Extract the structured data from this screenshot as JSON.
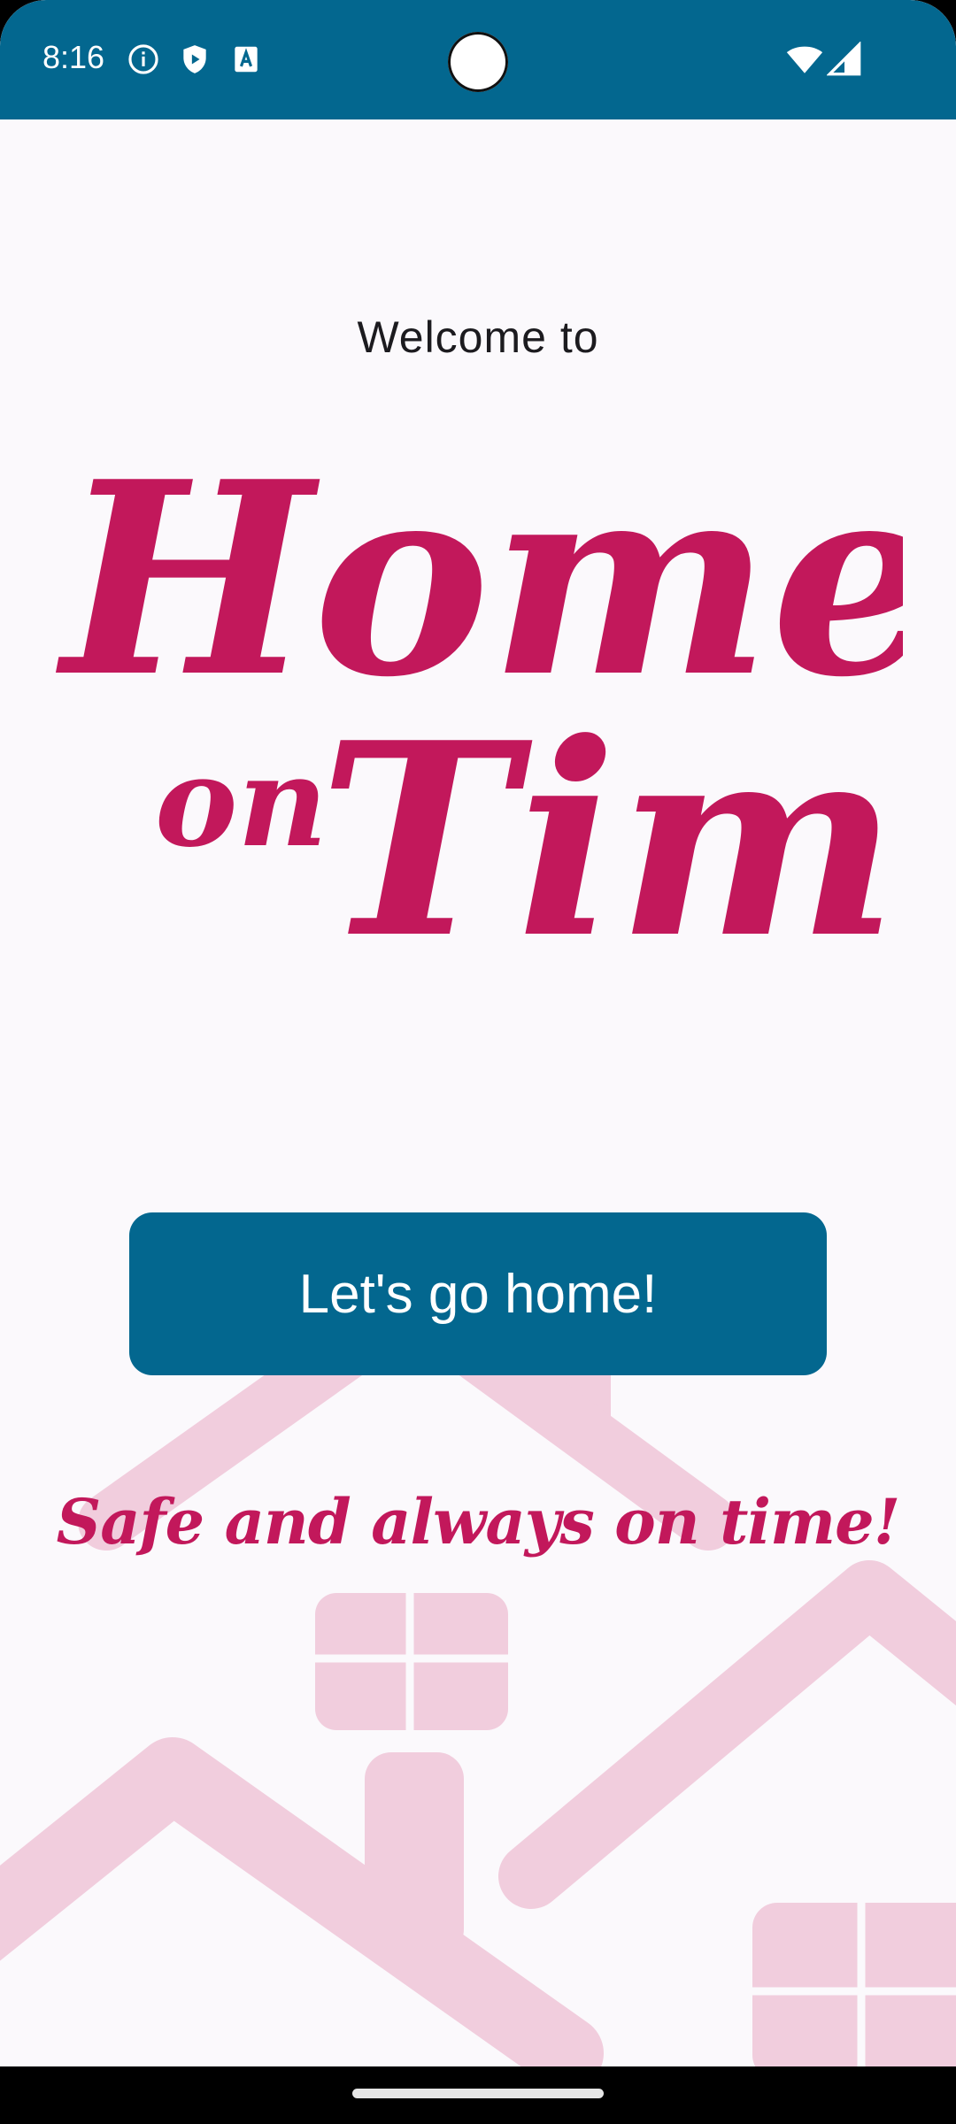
{
  "status_bar": {
    "time": "8:16",
    "left_icons": [
      "info-icon",
      "shield-play-icon",
      "text-a-icon"
    ],
    "right_icons": [
      "wifi-icon",
      "signal-icon"
    ],
    "background_color": "#03678f"
  },
  "welcome": {
    "greeting": "Welcome to",
    "logo_line1": "Home",
    "logo_small": "on",
    "logo_line2": "Time",
    "brand_color": "#c2185b"
  },
  "actions": {
    "go_home_label": "Let's go home!",
    "button_color": "#03678f"
  },
  "tagline": "Safe and always on time!",
  "background": {
    "illustration": "houses-illustration",
    "illustration_color": "#f1cddd"
  },
  "nav": {
    "handle": "home-handle"
  }
}
